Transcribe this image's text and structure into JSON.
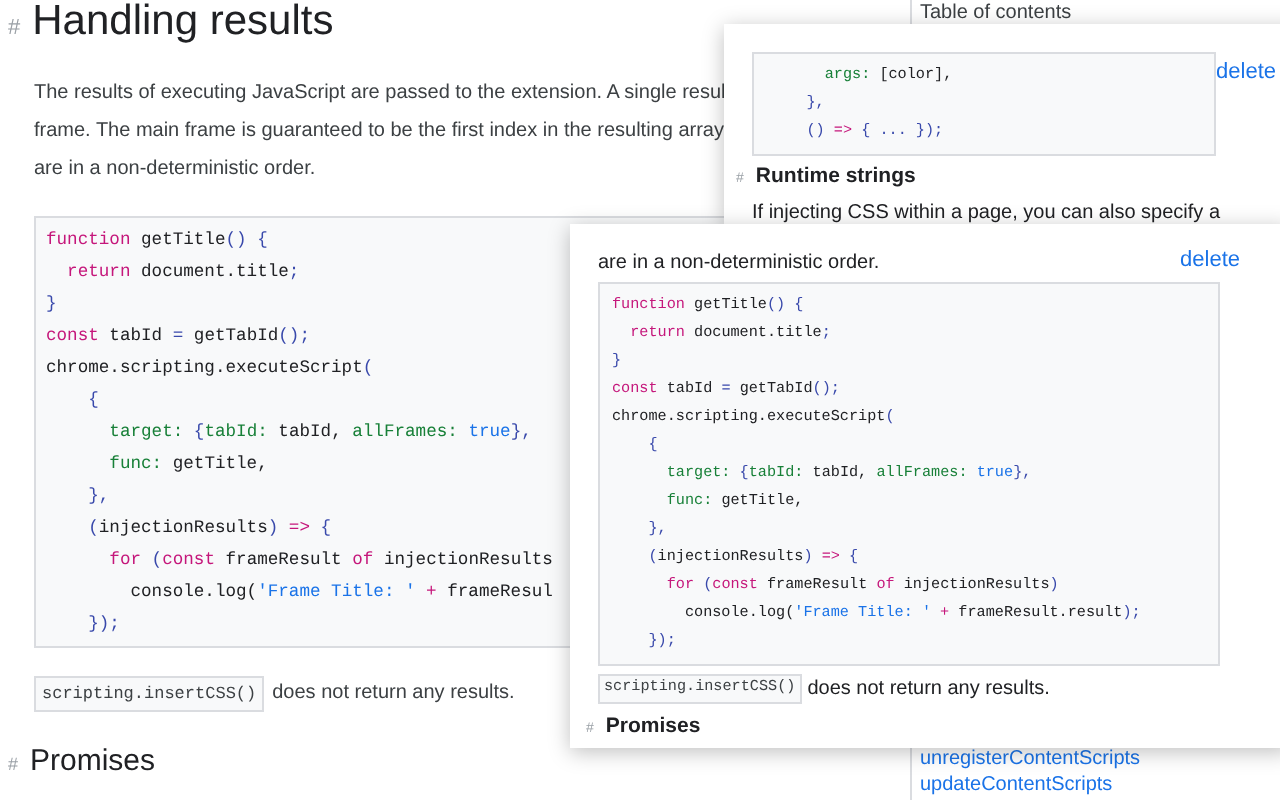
{
  "page": {
    "heading": {
      "anchor": "#",
      "text": "Handling results"
    },
    "paragraph_lines": [
      "The results of executing JavaScript are passed to the extension. A single resul",
      "frame. The main frame is guaranteed to be the first index in the resulting array",
      "are in a non-deterministic order."
    ],
    "code": [
      [
        {
          "kind": "kw",
          "text": "function"
        },
        {
          "kind": "plain",
          "text": " getTitle"
        },
        {
          "kind": "punct",
          "text": "() {"
        }
      ],
      [
        {
          "kind": "kw",
          "text": "  return"
        },
        {
          "kind": "plain",
          "text": " document.title"
        },
        {
          "kind": "punct",
          "text": ";"
        }
      ],
      [
        {
          "kind": "punct",
          "text": "}"
        }
      ],
      [
        {
          "kind": "kw",
          "text": "const"
        },
        {
          "kind": "plain",
          "text": " tabId "
        },
        {
          "kind": "punct",
          "text": "="
        },
        {
          "kind": "plain",
          "text": " getTabId"
        },
        {
          "kind": "punct",
          "text": "();"
        }
      ],
      [
        {
          "kind": "plain",
          "text": "chrome.scripting.executeScript"
        },
        {
          "kind": "punct",
          "text": "("
        }
      ],
      [
        {
          "kind": "punct",
          "text": "    {"
        }
      ],
      [
        {
          "kind": "prop",
          "text": "      target:"
        },
        {
          "kind": "punct",
          "text": " {"
        },
        {
          "kind": "prop",
          "text": "tabId:"
        },
        {
          "kind": "plain",
          "text": " tabId, "
        },
        {
          "kind": "prop",
          "text": "allFrames:"
        },
        {
          "kind": "lit",
          "text": " true"
        },
        {
          "kind": "punct",
          "text": "},"
        }
      ],
      [
        {
          "kind": "prop",
          "text": "      func:"
        },
        {
          "kind": "plain",
          "text": " getTitle,"
        }
      ],
      [
        {
          "kind": "punct",
          "text": "    },"
        }
      ],
      [
        {
          "kind": "punct",
          "text": "    ("
        },
        {
          "kind": "plain",
          "text": "injectionResults"
        },
        {
          "kind": "punct",
          "text": ")"
        },
        {
          "kind": "kw",
          "text": " =>"
        },
        {
          "kind": "punct",
          "text": " {"
        }
      ],
      [
        {
          "kind": "kw",
          "text": "      for"
        },
        {
          "kind": "punct",
          "text": " ("
        },
        {
          "kind": "kw",
          "text": "const"
        },
        {
          "kind": "plain",
          "text": " frameResult "
        },
        {
          "kind": "kw",
          "text": "of"
        },
        {
          "kind": "plain",
          "text": " injectionResults"
        }
      ],
      [
        {
          "kind": "plain",
          "text": "        console.log("
        },
        {
          "kind": "lit",
          "text": "'Frame Title: '"
        },
        {
          "kind": "kw",
          "text": " +"
        },
        {
          "kind": "plain",
          "text": " frameResul"
        }
      ],
      [
        {
          "kind": "punct",
          "text": "    });"
        }
      ]
    ],
    "inline_code": "scripting.insertCSS()",
    "after_code": "does not return any results.",
    "next_heading": {
      "anchor": "#",
      "text": "Promises"
    }
  },
  "toc": {
    "title": "Table of contents",
    "links": [
      "unregisterContentScripts",
      "updateContentScripts"
    ]
  },
  "cards": [
    {
      "delete": "delete",
      "code": [
        [
          {
            "kind": "prop",
            "text": "      args:"
          },
          {
            "kind": "plain",
            "text": " [color],"
          }
        ],
        [
          {
            "kind": "punct",
            "text": "    },"
          }
        ],
        [
          {
            "kind": "punct",
            "text": "    () "
          },
          {
            "kind": "kw",
            "text": "=>"
          },
          {
            "kind": "punct",
            "text": " { ... });"
          }
        ]
      ],
      "heading": {
        "anchor": "#",
        "text": "Runtime strings"
      },
      "text": "If injecting CSS within a page, you can also specify a"
    },
    {
      "delete": "delete",
      "intro": "are in a non-deterministic order.",
      "code": [
        [
          {
            "kind": "kw",
            "text": "function"
          },
          {
            "kind": "plain",
            "text": " getTitle"
          },
          {
            "kind": "punct",
            "text": "() {"
          }
        ],
        [
          {
            "kind": "kw",
            "text": "  return"
          },
          {
            "kind": "plain",
            "text": " document.title"
          },
          {
            "kind": "punct",
            "text": ";"
          }
        ],
        [
          {
            "kind": "punct",
            "text": "}"
          }
        ],
        [
          {
            "kind": "kw",
            "text": "const"
          },
          {
            "kind": "plain",
            "text": " tabId "
          },
          {
            "kind": "punct",
            "text": "="
          },
          {
            "kind": "plain",
            "text": " getTabId"
          },
          {
            "kind": "punct",
            "text": "();"
          }
        ],
        [
          {
            "kind": "plain",
            "text": "chrome.scripting.executeScript"
          },
          {
            "kind": "punct",
            "text": "("
          }
        ],
        [
          {
            "kind": "punct",
            "text": "    {"
          }
        ],
        [
          {
            "kind": "prop",
            "text": "      target:"
          },
          {
            "kind": "punct",
            "text": " {"
          },
          {
            "kind": "prop",
            "text": "tabId:"
          },
          {
            "kind": "plain",
            "text": " tabId, "
          },
          {
            "kind": "prop",
            "text": "allFrames:"
          },
          {
            "kind": "lit",
            "text": " true"
          },
          {
            "kind": "punct",
            "text": "},"
          }
        ],
        [
          {
            "kind": "prop",
            "text": "      func:"
          },
          {
            "kind": "plain",
            "text": " getTitle,"
          }
        ],
        [
          {
            "kind": "punct",
            "text": "    },"
          }
        ],
        [
          {
            "kind": "punct",
            "text": "    ("
          },
          {
            "kind": "plain",
            "text": "injectionResults"
          },
          {
            "kind": "punct",
            "text": ")"
          },
          {
            "kind": "kw",
            "text": " =>"
          },
          {
            "kind": "punct",
            "text": " {"
          }
        ],
        [
          {
            "kind": "kw",
            "text": "      for"
          },
          {
            "kind": "punct",
            "text": " ("
          },
          {
            "kind": "kw",
            "text": "const"
          },
          {
            "kind": "plain",
            "text": " frameResult "
          },
          {
            "kind": "kw",
            "text": "of"
          },
          {
            "kind": "plain",
            "text": " injectionResults"
          },
          {
            "kind": "punct",
            "text": ")"
          }
        ],
        [
          {
            "kind": "plain",
            "text": "        console.log("
          },
          {
            "kind": "lit",
            "text": "'Frame Title: '"
          },
          {
            "kind": "kw",
            "text": " +"
          },
          {
            "kind": "plain",
            "text": " frameResult.result"
          },
          {
            "kind": "punct",
            "text": ");"
          }
        ],
        [
          {
            "kind": "punct",
            "text": "    });"
          }
        ]
      ],
      "inline_code": "scripting.insertCSS()",
      "after_code": "does not return any results.",
      "heading": {
        "anchor": "#",
        "text": "Promises"
      }
    }
  ]
}
